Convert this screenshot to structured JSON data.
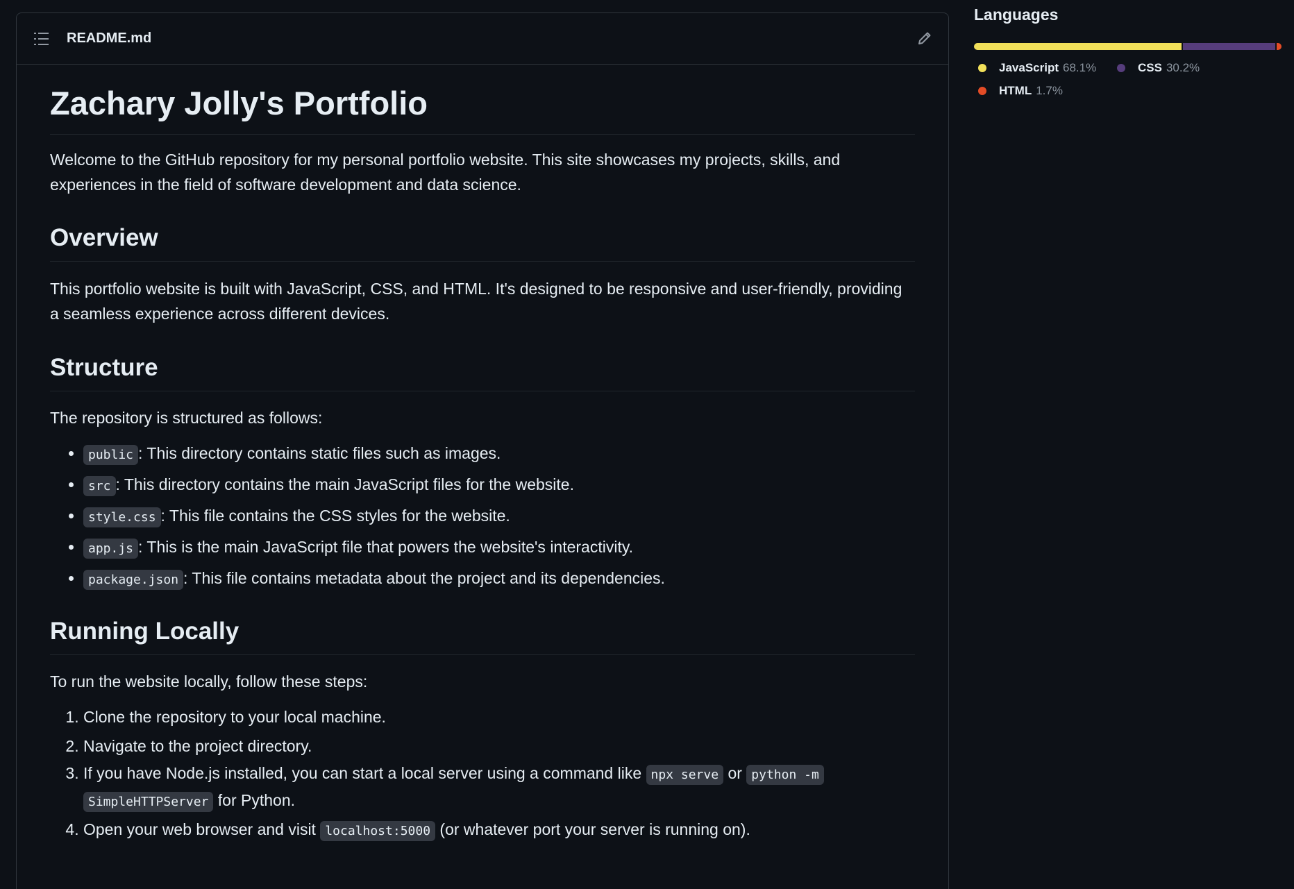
{
  "readme": {
    "filename": "README.md",
    "title": "Zachary Jolly's Portfolio",
    "intro": "Welcome to the GitHub repository for my personal portfolio website. This site showcases my projects, skills, and experiences in the field of software development and data science.",
    "overview": {
      "heading": "Overview",
      "text": "This portfolio website is built with JavaScript, CSS, and HTML. It's designed to be responsive and user-friendly, providing a seamless experience across different devices."
    },
    "structure": {
      "heading": "Structure",
      "intro": "The repository is structured as follows:",
      "items": [
        {
          "code": "public",
          "text": ": This directory contains static files such as images."
        },
        {
          "code": "src",
          "text": ": This directory contains the main JavaScript files for the website."
        },
        {
          "code": "style.css",
          "text": ": This file contains the CSS styles for the website."
        },
        {
          "code": "app.js",
          "text": ": This is the main JavaScript file that powers the website's interactivity."
        },
        {
          "code": "package.json",
          "text": ": This file contains metadata about the project and its dependencies."
        }
      ]
    },
    "running": {
      "heading": "Running Locally",
      "intro": "To run the website locally, follow these steps:",
      "step1": "Clone the repository to your local machine.",
      "step2": "Navigate to the project directory.",
      "step3": {
        "pre": "If you have Node.js installed, you can start a local server using a command like ",
        "code1": "npx serve",
        "mid": " or ",
        "code2a": "python -m",
        "code2b": "SimpleHTTPServer",
        "post": " for Python."
      },
      "step4": {
        "pre": "Open your web browser and visit ",
        "code": "localhost:5000",
        "post": " (or whatever port your server is running on)."
      }
    }
  },
  "languages": {
    "title": "Languages",
    "items": [
      {
        "name": "JavaScript",
        "percent": "68.1%",
        "value": 68.1,
        "color": "#f1e05a"
      },
      {
        "name": "CSS",
        "percent": "30.2%",
        "value": 30.2,
        "color": "#563d7c"
      },
      {
        "name": "HTML",
        "percent": "1.7%",
        "value": 1.7,
        "color": "#e34c26"
      }
    ]
  },
  "icons": {
    "toc": "list-unordered-icon",
    "edit": "pencil-icon"
  }
}
